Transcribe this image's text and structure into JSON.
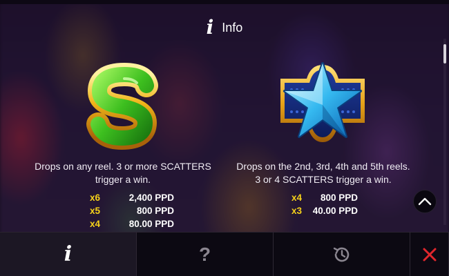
{
  "header": {
    "icon": "info-icon",
    "title": "Info"
  },
  "symbols": [
    {
      "icon": "dollar-sign-icon",
      "description": "Drops on any reel. 3 or more SCATTERS trigger a win.",
      "pays": [
        {
          "multiplier": "x6",
          "amount": "2,400 PPD"
        },
        {
          "multiplier": "x5",
          "amount": "800 PPD"
        },
        {
          "multiplier": "x4",
          "amount": "80.00 PPD"
        }
      ]
    },
    {
      "icon": "blue-star-icon",
      "description": "Drops on the 2nd, 3rd, 4th and 5th reels. 3 or 4 SCATTERS trigger a win.",
      "pays": [
        {
          "multiplier": "x4",
          "amount": "800 PPD"
        },
        {
          "multiplier": "x3",
          "amount": "40.00 PPD"
        }
      ]
    }
  ],
  "bottom_nav": [
    {
      "icon": "info-icon",
      "glyph": "i",
      "active": true
    },
    {
      "icon": "question-icon",
      "glyph": "?",
      "active": false
    },
    {
      "icon": "history-icon",
      "active": false
    },
    {
      "icon": "close-icon",
      "active": false
    }
  ],
  "colors": {
    "multiplier": "#f6d21a",
    "close": "#e0262c",
    "text": "#ffffff"
  }
}
